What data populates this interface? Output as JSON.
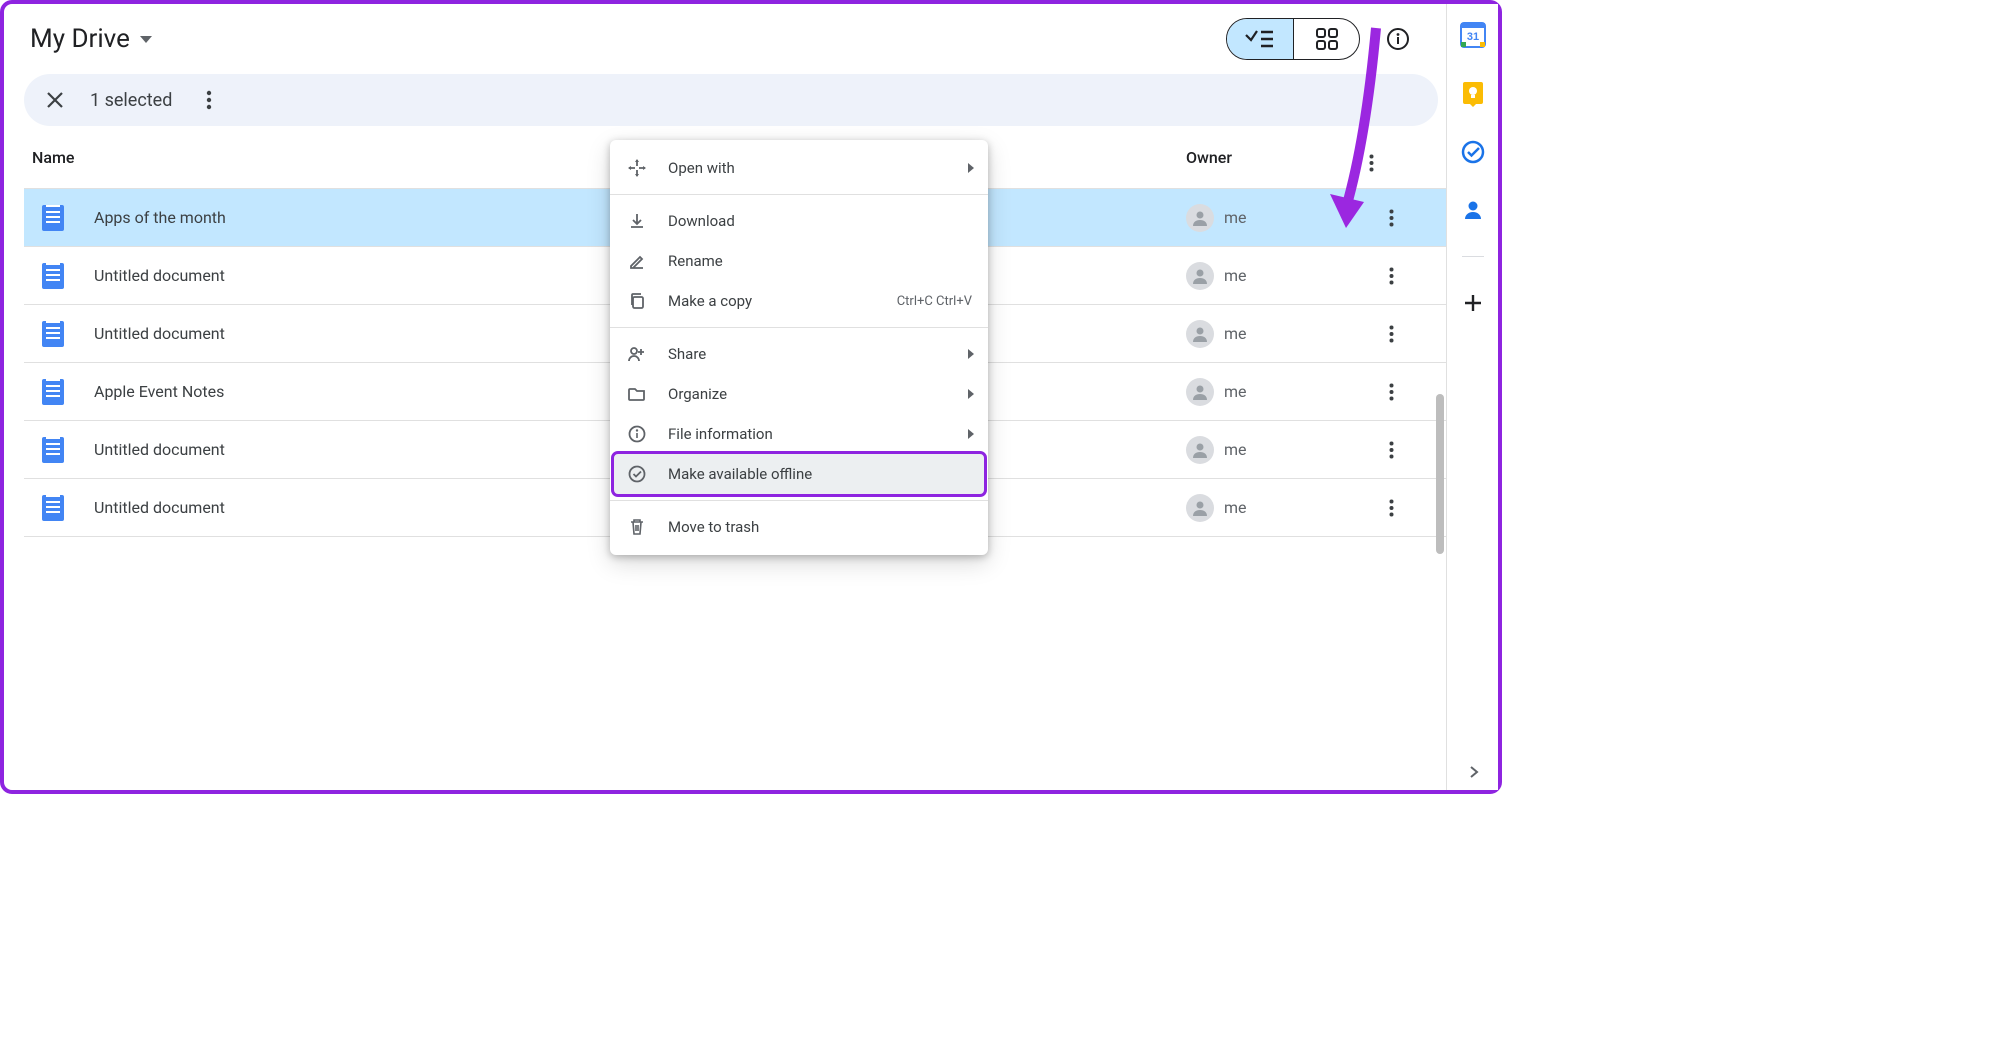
{
  "header": {
    "title": "My Drive"
  },
  "selection_bar": {
    "text": "1 selected"
  },
  "columns": {
    "name": "Name",
    "owner": "Owner"
  },
  "owner_label": "me",
  "files": [
    {
      "name": "Apps of the month",
      "owner": "me",
      "selected": true
    },
    {
      "name": "Untitled document",
      "owner": "me",
      "selected": false
    },
    {
      "name": "Untitled document",
      "owner": "me",
      "selected": false
    },
    {
      "name": "Apple Event Notes",
      "owner": "me",
      "selected": false
    },
    {
      "name": "Untitled document",
      "owner": "me",
      "selected": false
    },
    {
      "name": "Untitled document",
      "owner": "me",
      "selected": false
    }
  ],
  "menu": {
    "open_with": "Open with",
    "download": "Download",
    "rename": "Rename",
    "make_copy": "Make a copy",
    "make_copy_sc": "Ctrl+C Ctrl+V",
    "share": "Share",
    "organize": "Organize",
    "file_info": "File information",
    "offline": "Make available offline",
    "trash": "Move to trash"
  },
  "side_panel": {
    "calendar_day": "31"
  }
}
